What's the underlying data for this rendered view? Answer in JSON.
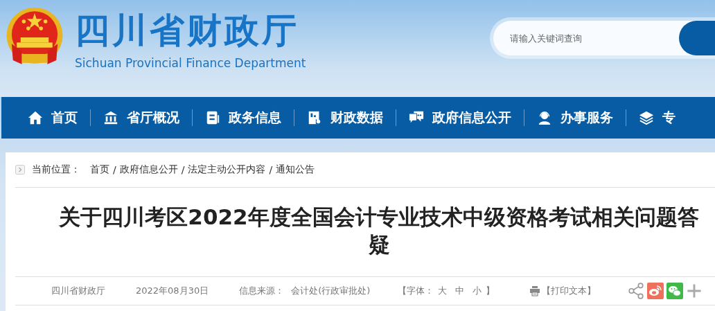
{
  "site": {
    "title": "四川省财政厅",
    "subtitle": "Sichuan Provincial Finance Department"
  },
  "search": {
    "placeholder": "请输入关键词查询"
  },
  "nav": [
    {
      "label": "首页"
    },
    {
      "label": "省厅概况"
    },
    {
      "label": "政务信息"
    },
    {
      "label": "财政数据"
    },
    {
      "label": "政府信息公开"
    },
    {
      "label": "办事服务"
    },
    {
      "label": "专"
    }
  ],
  "breadcrumb": {
    "label": "当前位置：",
    "items": [
      {
        "kind": "link",
        "text": "首页"
      },
      {
        "kind": "separator",
        "text": "/"
      },
      {
        "kind": "link",
        "text": "政府信息公开"
      },
      {
        "kind": "separator",
        "text": "/"
      },
      {
        "kind": "link",
        "text": "法定主动公开内容"
      },
      {
        "kind": "separator",
        "text": "/"
      },
      {
        "kind": "link",
        "text": "通知公告"
      }
    ]
  },
  "article": {
    "title": "关于四川考区2022年度全国会计专业技术中级资格考试相关问题答疑",
    "publisher": "四川省财政厅",
    "date": "2022年08月30日",
    "source_label": "信息来源：",
    "source": "会计处(行政审批处)",
    "font_size": {
      "open": "【字体：",
      "options": [
        "大",
        "中",
        "小"
      ],
      "close": "】"
    },
    "print": "【打印文本】",
    "share": [
      {
        "kind": "share"
      },
      {
        "kind": "weibo"
      },
      {
        "kind": "wechat"
      },
      {
        "kind": "more"
      }
    ]
  }
}
